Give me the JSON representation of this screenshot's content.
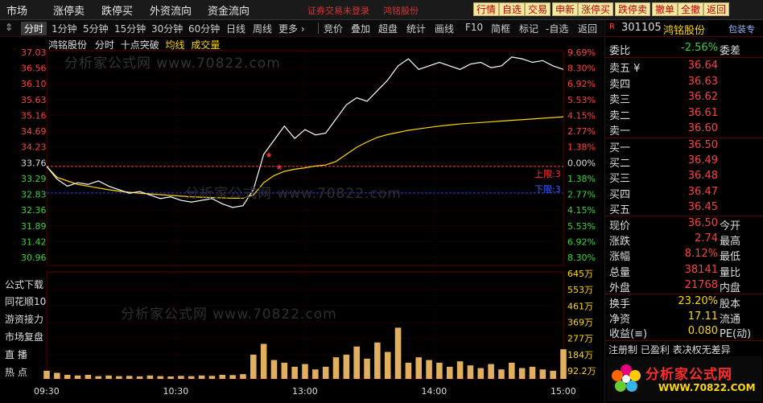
{
  "menu": [
    "市场",
    "涨停卖",
    "跌停买",
    "外资流向",
    "资金流向"
  ],
  "notice": "证券交易未登录",
  "notice_stock": "鸿铭股份",
  "toolbar": [
    "行情",
    "自选",
    "交易",
    "申新",
    "涨停买",
    "跌停卖",
    "撤单",
    "全撤",
    "返回"
  ],
  "period_tabs": [
    "分时",
    "1分钟",
    "5分钟",
    "15分钟",
    "30分钟",
    "60分钟",
    "日线",
    "周线",
    "更多 ›"
  ],
  "tools": [
    "竞价",
    "叠加",
    "超盘",
    "统计",
    "画线",
    "F10",
    "简框",
    "标记",
    "-自选",
    "返回"
  ],
  "chart_header": {
    "name": "鸿铭股份",
    "mode": "分时",
    "indicator": "十点突破",
    "avg": "均线",
    "vol": "成交量"
  },
  "side_labels": [
    "公式下载",
    "同花顺10",
    "游资接力",
    "市场复盘",
    "直  播",
    "热  点"
  ],
  "limit_up_label": "上限:3",
  "limit_down_label": "下限:3",
  "watermark": "分析家公式网 www.70822.com",
  "chart_data": {
    "type": "line",
    "price_axis": [
      "37.03",
      "36.56",
      "36.10",
      "35.63",
      "35.16",
      "34.69",
      "34.23",
      "33.76",
      "33.29",
      "32.83",
      "32.36",
      "31.89",
      "31.42",
      "30.96"
    ],
    "pct_axis": [
      "9.69%",
      "8.30%",
      "6.92%",
      "5.53%",
      "4.15%",
      "2.77%",
      "1.38%",
      "0.00%",
      "1.38%",
      "2.77%",
      "4.15%",
      "5.53%",
      "6.92%",
      "8.30%"
    ],
    "vol_axis": [
      "645万",
      "553万",
      "461万",
      "369万",
      "277万",
      "184万",
      "92.2万"
    ],
    "time_axis": [
      "09:30",
      "10:30",
      "13:00",
      "14:00",
      "15:00"
    ],
    "prev_close": 33.76,
    "ylim": [
      30.96,
      37.03
    ],
    "price": [
      33.76,
      33.4,
      33.2,
      33.3,
      33.25,
      33.35,
      33.2,
      33.1,
      33.0,
      33.05,
      32.95,
      32.85,
      32.9,
      32.8,
      32.75,
      32.8,
      32.85,
      32.7,
      32.6,
      32.65,
      33.1,
      34.1,
      34.5,
      34.9,
      34.55,
      34.8,
      34.65,
      34.7,
      35.1,
      35.5,
      35.7,
      35.6,
      35.9,
      36.2,
      36.6,
      36.8,
      36.5,
      36.6,
      36.7,
      36.6,
      36.5,
      36.65,
      36.7,
      36.55,
      36.6,
      36.85,
      36.8,
      36.7,
      36.75,
      36.6,
      36.5
    ],
    "avg": [
      33.76,
      33.45,
      33.35,
      33.25,
      33.2,
      33.15,
      33.1,
      33.06,
      33.03,
      33.0,
      32.98,
      32.96,
      32.94,
      32.92,
      32.9,
      32.89,
      32.88,
      32.87,
      32.86,
      32.86,
      32.95,
      33.3,
      33.5,
      33.62,
      33.68,
      33.72,
      33.77,
      33.8,
      33.9,
      34.1,
      34.3,
      34.45,
      34.58,
      34.66,
      34.72,
      34.78,
      34.82,
      34.86,
      34.9,
      34.93,
      34.96,
      34.98,
      35.0,
      35.02,
      35.04,
      35.06,
      35.08,
      35.1,
      35.12,
      35.14,
      35.16
    ],
    "volume": [
      60,
      45,
      30,
      25,
      30,
      20,
      25,
      20,
      22,
      18,
      25,
      20,
      18,
      22,
      20,
      25,
      22,
      30,
      28,
      35,
      180,
      260,
      140,
      120,
      90,
      110,
      70,
      90,
      160,
      180,
      240,
      150,
      270,
      200,
      380,
      120,
      160,
      140,
      120,
      90,
      130,
      100,
      80,
      110,
      70,
      120,
      80,
      90,
      70,
      60,
      220
    ]
  },
  "panel": {
    "code": "301105",
    "name": "鸿铭股份",
    "ticker_right": "包装专",
    "ratio": {
      "label": "委比",
      "value": "-2.56%",
      "label2": "委差"
    },
    "asks": [
      {
        "label": "卖五 ¥",
        "price": "36.64"
      },
      {
        "label": "卖四",
        "price": "36.63"
      },
      {
        "label": "卖三",
        "price": "36.62"
      },
      {
        "label": "卖二",
        "price": "36.61"
      },
      {
        "label": "卖一",
        "price": "36.60"
      }
    ],
    "bids": [
      {
        "label": "买一",
        "price": "36.50"
      },
      {
        "label": "买二",
        "price": "36.49"
      },
      {
        "label": "买三",
        "price": "36.48"
      },
      {
        "label": "买四",
        "price": "36.47"
      },
      {
        "label": "买五",
        "price": "36.45"
      }
    ],
    "stats": [
      {
        "label": "现价",
        "value": "36.50",
        "label2": "今开"
      },
      {
        "label": "涨跌",
        "value": "2.74",
        "label2": "最高"
      },
      {
        "label": "涨幅",
        "value": "8.12%",
        "label2": "最低"
      },
      {
        "label": "总量",
        "value": "38141",
        "label2": "量比"
      },
      {
        "label": "外盘",
        "value": "21768",
        "label2": "内盘"
      }
    ],
    "stats2": [
      {
        "label": "换手",
        "value": "23.20%",
        "label2": "股本"
      },
      {
        "label": "净资",
        "value": "17.11",
        "label2": "流通"
      },
      {
        "label": "收益(≡)",
        "value": "0.080",
        "label2": "PE(动)"
      }
    ],
    "footer": "注册制 已盈利 表决权无差异",
    "logo": "分析家公式网",
    "logo_url": "WWW.70822.COM"
  }
}
